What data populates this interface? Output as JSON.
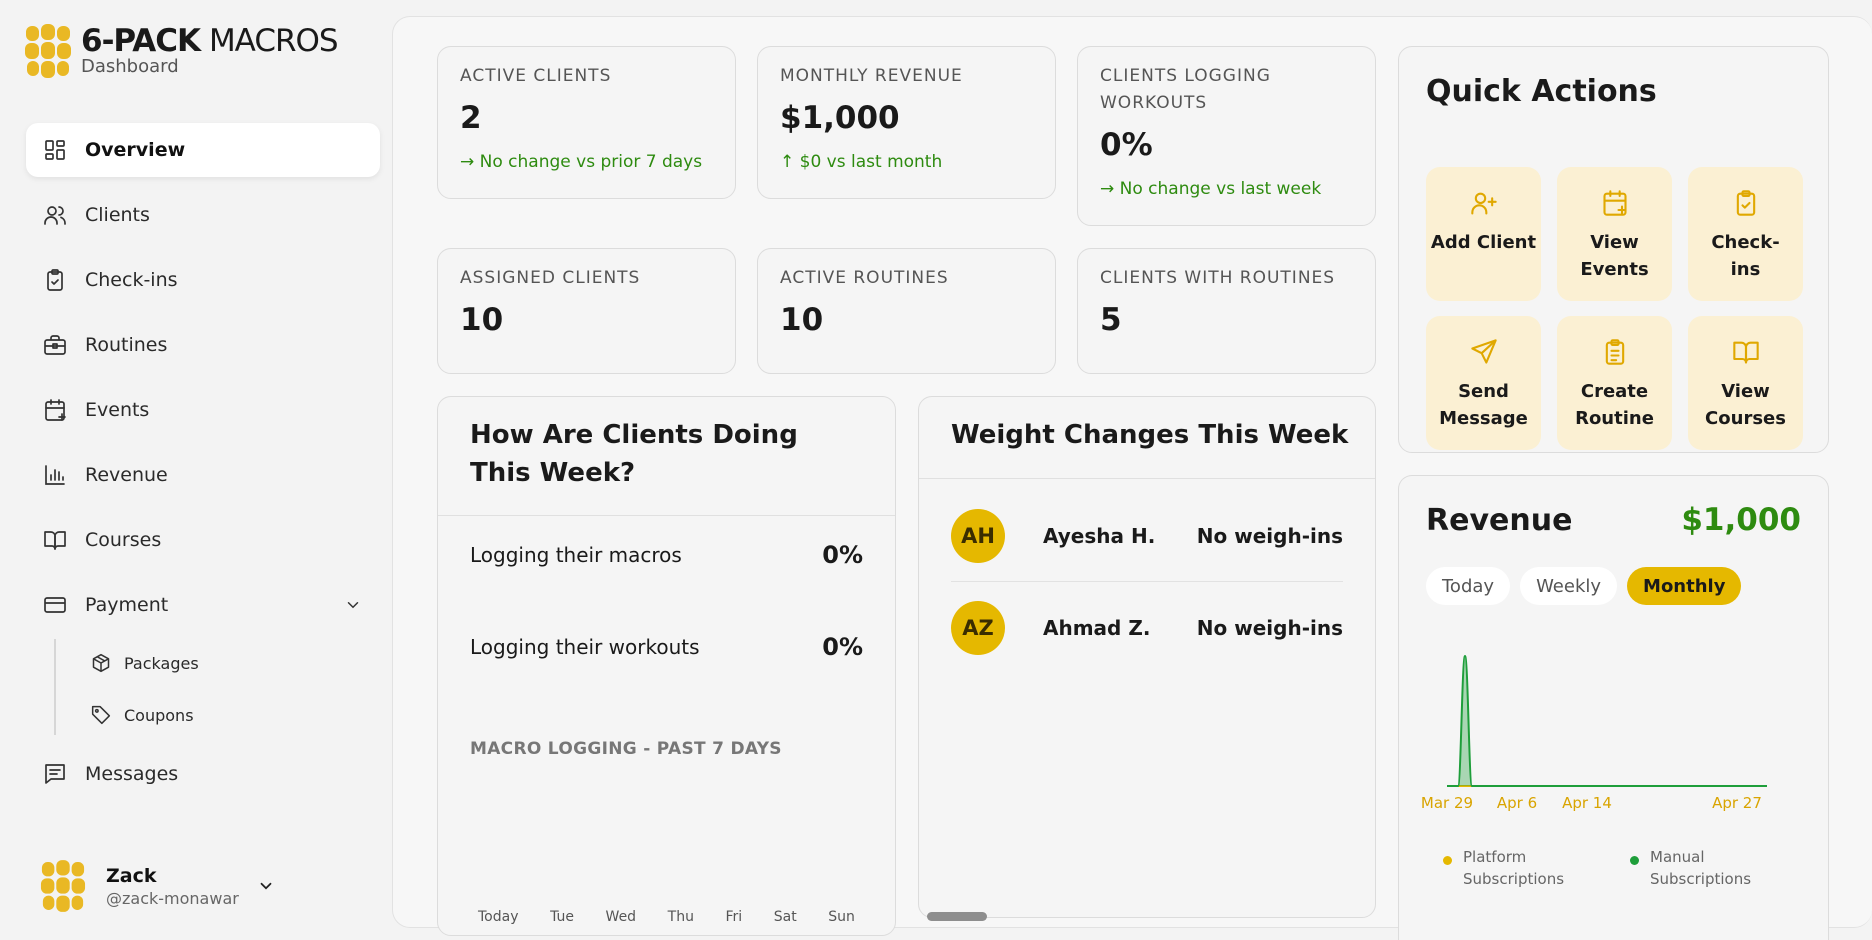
{
  "brand": {
    "name_bold": "6-PACK",
    "name_light": "MACROS",
    "subtitle": "Dashboard"
  },
  "sidebar": {
    "items": [
      {
        "label": "Overview",
        "icon": "grid-icon",
        "active": true
      },
      {
        "label": "Clients",
        "icon": "users-icon"
      },
      {
        "label": "Check-ins",
        "icon": "clipboard-check-icon"
      },
      {
        "label": "Routines",
        "icon": "briefcase-icon"
      },
      {
        "label": "Events",
        "icon": "calendar-plus-icon"
      },
      {
        "label": "Revenue",
        "icon": "bar-chart-icon"
      },
      {
        "label": "Courses",
        "icon": "book-open-icon"
      },
      {
        "label": "Payment",
        "icon": "credit-card-icon",
        "expanded": true
      },
      {
        "label": "Messages",
        "icon": "message-icon"
      }
    ],
    "payment_sub": [
      {
        "label": "Packages",
        "icon": "package-icon"
      },
      {
        "label": "Coupons",
        "icon": "tag-icon"
      }
    ]
  },
  "user": {
    "name": "Zack",
    "handle": "@zack-monawar"
  },
  "stats": [
    {
      "label": "ACTIVE CLIENTS",
      "value": "2",
      "change": "→ No change vs prior 7 days"
    },
    {
      "label": "MONTHLY REVENUE",
      "value": "$1,000",
      "change": "↑ $0 vs last month"
    },
    {
      "label": "CLIENTS LOGGING WORKOUTS",
      "value": "0%",
      "change": "→ No change vs last week"
    },
    {
      "label": "ASSIGNED CLIENTS",
      "value": "10"
    },
    {
      "label": "ACTIVE ROUTINES",
      "value": "10"
    },
    {
      "label": "CLIENTS WITH ROUTINES",
      "value": "5"
    }
  ],
  "clients_panel": {
    "title": "How Are Clients Doing This Week?",
    "metrics": [
      {
        "label": "Logging their macros",
        "value": "0%"
      },
      {
        "label": "Logging their workouts",
        "value": "0%"
      }
    ],
    "macro_caption": "MACRO LOGGING - PAST 7 DAYS",
    "days": [
      "Today",
      "Tue",
      "Wed",
      "Thu",
      "Fri",
      "Sat",
      "Sun"
    ]
  },
  "weight_panel": {
    "title": "Weight Changes This Week",
    "rows": [
      {
        "initials": "AH",
        "name": "Ayesha H.",
        "status": "No weigh-ins"
      },
      {
        "initials": "AZ",
        "name": "Ahmad Z.",
        "status": "No weigh-ins"
      }
    ]
  },
  "quick_actions": {
    "title": "Quick Actions",
    "buttons": [
      {
        "label": "Add Client",
        "icon": "user-plus-icon"
      },
      {
        "label": "View Events",
        "icon": "calendar-plus-icon"
      },
      {
        "label": "Check-ins",
        "icon": "clipboard-check-icon"
      },
      {
        "label": "Send Message",
        "icon": "send-icon"
      },
      {
        "label": "Create Routine",
        "icon": "clipboard-list-icon"
      },
      {
        "label": "View Courses",
        "icon": "book-open-icon"
      }
    ]
  },
  "revenue": {
    "title": "Revenue",
    "total": "$1,000",
    "tabs": [
      "Today",
      "Weekly",
      "Monthly"
    ],
    "active_tab": "Monthly",
    "legend": [
      {
        "label": "Platform Subscriptions",
        "color": "#e5b800"
      },
      {
        "label": "Manual Subscriptions",
        "color": "#1e9e3a"
      }
    ]
  },
  "chart_data": {
    "type": "area",
    "x_ticks": [
      "Mar 29",
      "Apr 6",
      "Apr 14",
      "Apr 27"
    ],
    "series": [
      {
        "name": "Platform Subscriptions",
        "color": "#e5b800",
        "points": [
          [
            "Mar 29",
            0
          ],
          [
            "Apr 1",
            0
          ],
          [
            "Apr 6",
            0
          ],
          [
            "Apr 14",
            0
          ],
          [
            "Apr 27",
            0
          ]
        ]
      },
      {
        "name": "Manual Subscriptions",
        "color": "#1e9e3a",
        "points": [
          [
            "Mar 29",
            0
          ],
          [
            "Apr 1",
            1000
          ],
          [
            "Apr 6",
            0
          ],
          [
            "Apr 14",
            0
          ],
          [
            "Apr 27",
            0
          ]
        ]
      }
    ]
  },
  "colors": {
    "accent": "#e5b800",
    "positive": "#2e8b10",
    "revenue_green": "#2e8b10",
    "qa_bg": "#fbf0d3"
  }
}
